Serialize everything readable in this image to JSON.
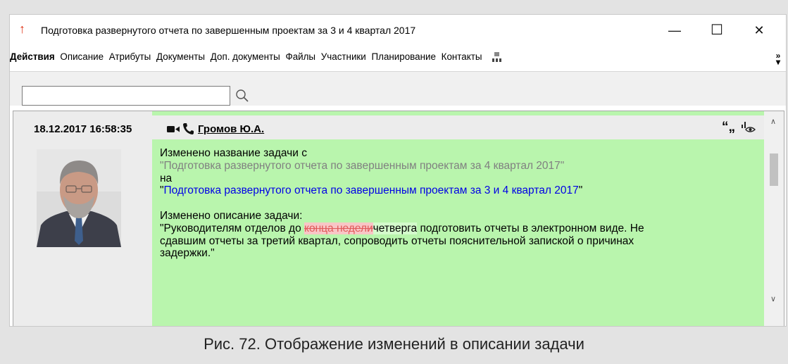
{
  "window": {
    "title": "Подготовка развернутого отчета  по завершенным проектам за 3 и 4 квартал 2017",
    "icon": "up-arrow-icon",
    "controls": {
      "minimize": "—",
      "maximize": "☐",
      "close": "✕"
    }
  },
  "menu": {
    "items": [
      {
        "label": "Действия",
        "active": true
      },
      {
        "label": "Описание"
      },
      {
        "label": "Атрибуты"
      },
      {
        "label": "Документы"
      },
      {
        "label": "Доп. документы"
      },
      {
        "label": "Файлы"
      },
      {
        "label": "Участники"
      },
      {
        "label": "Планирование"
      },
      {
        "label": "Контакты"
      }
    ],
    "more_label": "»"
  },
  "search": {
    "value": "",
    "placeholder": ""
  },
  "entry": {
    "timestamp": "18.12.2017 16:58:35",
    "author": "Громов Ю.А.",
    "line1": "Изменено название задачи с",
    "old_title": "\"Подготовка развернутого отчета по завершенным проектам за 4 квартал 2017\"",
    "word_to": "на",
    "new_title_quote_open": "\"",
    "new_title": "Подготовка развернутого отчета по завершенным проектам за 3 и 4 квартал 2017",
    "new_title_quote_close": "\"",
    "line_desc": "Изменено описание задачи:",
    "desc_prefix": "\"Руководителям отделов до ",
    "desc_deleted": "конца недели",
    "desc_inserted": "четверга",
    "desc_rest1": " подготовить отчеты в электронном виде. Не",
    "desc_rest2": "сдавшим отчеты за третий квартал, сопроводить отчеты пояснительной запиской о причинах",
    "desc_rest3": "задержки.\""
  },
  "colors": {
    "highlight_green": "#b9f5ad",
    "old_text": "#808080",
    "new_text": "#0000e6",
    "deleted_text": "#e05a5a",
    "app_icon": "#e03a1e"
  },
  "caption": "Рис. 72. Отображение изменений в описании задачи"
}
